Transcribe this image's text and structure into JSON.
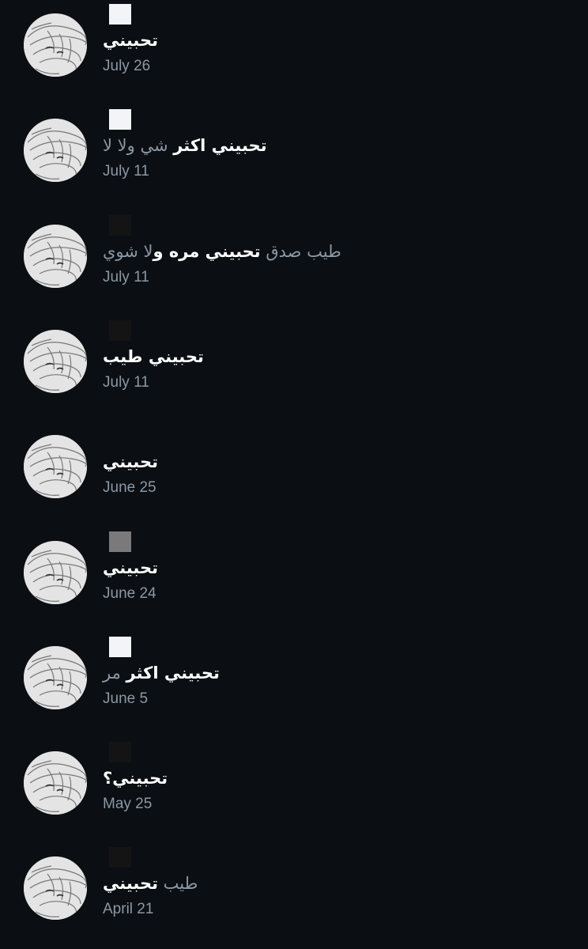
{
  "results": [
    {
      "parts": [
        {
          "text": "تحبيني",
          "style": "hl"
        }
      ],
      "date": "July 26",
      "redaction": "light"
    },
    {
      "parts": [
        {
          "text": "تحبيني اكثر",
          "style": "hl"
        },
        {
          "text": " شي ولا لا",
          "style": "dim"
        }
      ],
      "date": "July 11",
      "redaction": "light"
    },
    {
      "parts": [
        {
          "text": "طيب صدق ",
          "style": "dim"
        },
        {
          "text": "تحبيني مره و",
          "style": "hl"
        },
        {
          "text": "لا شوي",
          "style": "dim"
        }
      ],
      "date": "July 11",
      "redaction": "dark"
    },
    {
      "parts": [
        {
          "text": "تحبيني طيب",
          "style": "hl"
        }
      ],
      "date": "July 11",
      "redaction": "dark"
    },
    {
      "parts": [
        {
          "text": "تحبيني",
          "style": "hl"
        }
      ],
      "date": "June 25",
      "redaction": "none"
    },
    {
      "parts": [
        {
          "text": "تحبيني",
          "style": "hl"
        }
      ],
      "date": "June 24",
      "redaction": "mid"
    },
    {
      "parts": [
        {
          "text": "تحبيني اكثر",
          "style": "hl"
        },
        {
          "text": " مر",
          "style": "dim"
        }
      ],
      "date": "June 5",
      "redaction": "light"
    },
    {
      "parts": [
        {
          "text": "تحبيني؟",
          "style": "hl"
        }
      ],
      "date": "May 25",
      "redaction": "dark"
    },
    {
      "parts": [
        {
          "text": "طيب ",
          "style": "dim"
        },
        {
          "text": "تحبيني",
          "style": "hl"
        }
      ],
      "date": "April 21",
      "redaction": "dark"
    }
  ],
  "avatar_icon": "profile-photo-icon",
  "colors": {
    "background": "#0b0e12",
    "primary_text": "#ffffff",
    "secondary_text": "#8b98a5"
  }
}
